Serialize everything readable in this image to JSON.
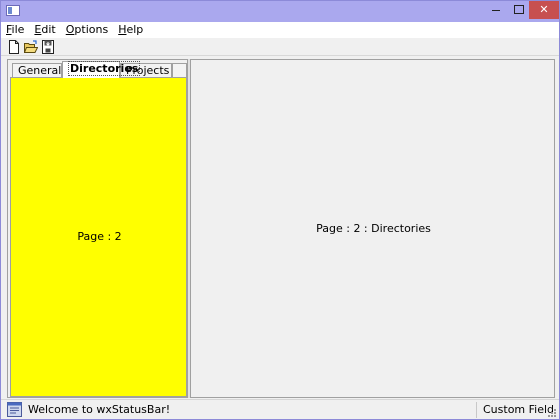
{
  "window": {
    "title": "",
    "close_glyph": "✕"
  },
  "menu": {
    "items": [
      {
        "label": "File",
        "accel": "F",
        "rest": "ile"
      },
      {
        "label": "Edit",
        "accel": "E",
        "rest": "dit"
      },
      {
        "label": "Options",
        "accel": "O",
        "rest": "ptions"
      },
      {
        "label": "Help",
        "accel": "H",
        "rest": "elp"
      }
    ]
  },
  "toolbar": {
    "icons": [
      "new-file-icon",
      "open-folder-icon",
      "save-icon"
    ]
  },
  "tabs": {
    "items": [
      "General",
      "Directories",
      "Projects"
    ],
    "active_index": 1
  },
  "left_page": {
    "label": "Page : 2",
    "color": "#ffff00"
  },
  "right_page": {
    "label": "Page : 2 : Directories"
  },
  "statusbar": {
    "welcome": "Welcome to wxStatusBar!",
    "custom_field": "Custom Field"
  },
  "colors": {
    "titlebar": "#aaa8ee",
    "close_button": "#c75050"
  }
}
